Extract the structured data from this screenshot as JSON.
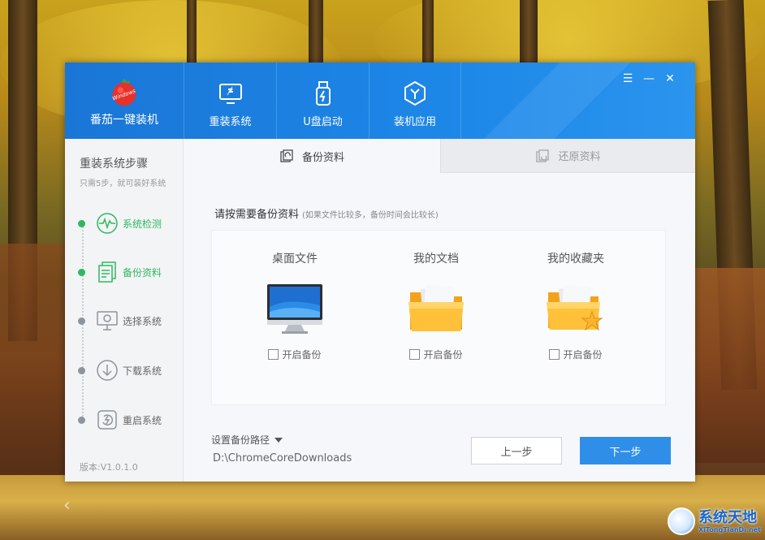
{
  "app": {
    "name": "番茄一键装机",
    "logo_text": "Windows"
  },
  "nav": [
    {
      "label": "重装系统",
      "icon": "monitor-refresh-icon"
    },
    {
      "label": "U盘启动",
      "icon": "usb-drive-icon"
    },
    {
      "label": "装机应用",
      "icon": "apps-hexagon-icon"
    }
  ],
  "window_controls": {
    "menu": "☰",
    "minimize": "—",
    "close": "✕"
  },
  "sidebar": {
    "title": "重装系统步骤",
    "subtitle": "只需5步，就可装好系统",
    "steps": [
      {
        "label": "系统检测",
        "state": "done"
      },
      {
        "label": "备份资料",
        "state": "done"
      },
      {
        "label": "选择系统",
        "state": "pending"
      },
      {
        "label": "下载系统",
        "state": "pending"
      },
      {
        "label": "重启系统",
        "state": "pending"
      }
    ],
    "version": "版本:V1.0.1.0"
  },
  "tabs": {
    "backup": "备份资料",
    "restore": "还原资料"
  },
  "instruction": {
    "main": "请按需要备份资料",
    "note": "(如果文件比较多，备份时间会比较长)"
  },
  "cards": [
    {
      "title": "桌面文件",
      "check_label": "开启备份",
      "checked": false
    },
    {
      "title": "我的文档",
      "check_label": "开启备份",
      "checked": false
    },
    {
      "title": "我的收藏夹",
      "check_label": "开启备份",
      "checked": false
    }
  ],
  "backup_path": {
    "label": "设置备份路径",
    "value": "D:\\ChromeCoreDownloads"
  },
  "buttons": {
    "prev": "上一步",
    "next": "下一步"
  },
  "watermark": {
    "cn": "系统天地",
    "en": "XiTongTianDi.net"
  },
  "colors": {
    "accent": "#2f8ee8",
    "titlebar": "#1d87e8",
    "step_done": "#2fb860"
  }
}
